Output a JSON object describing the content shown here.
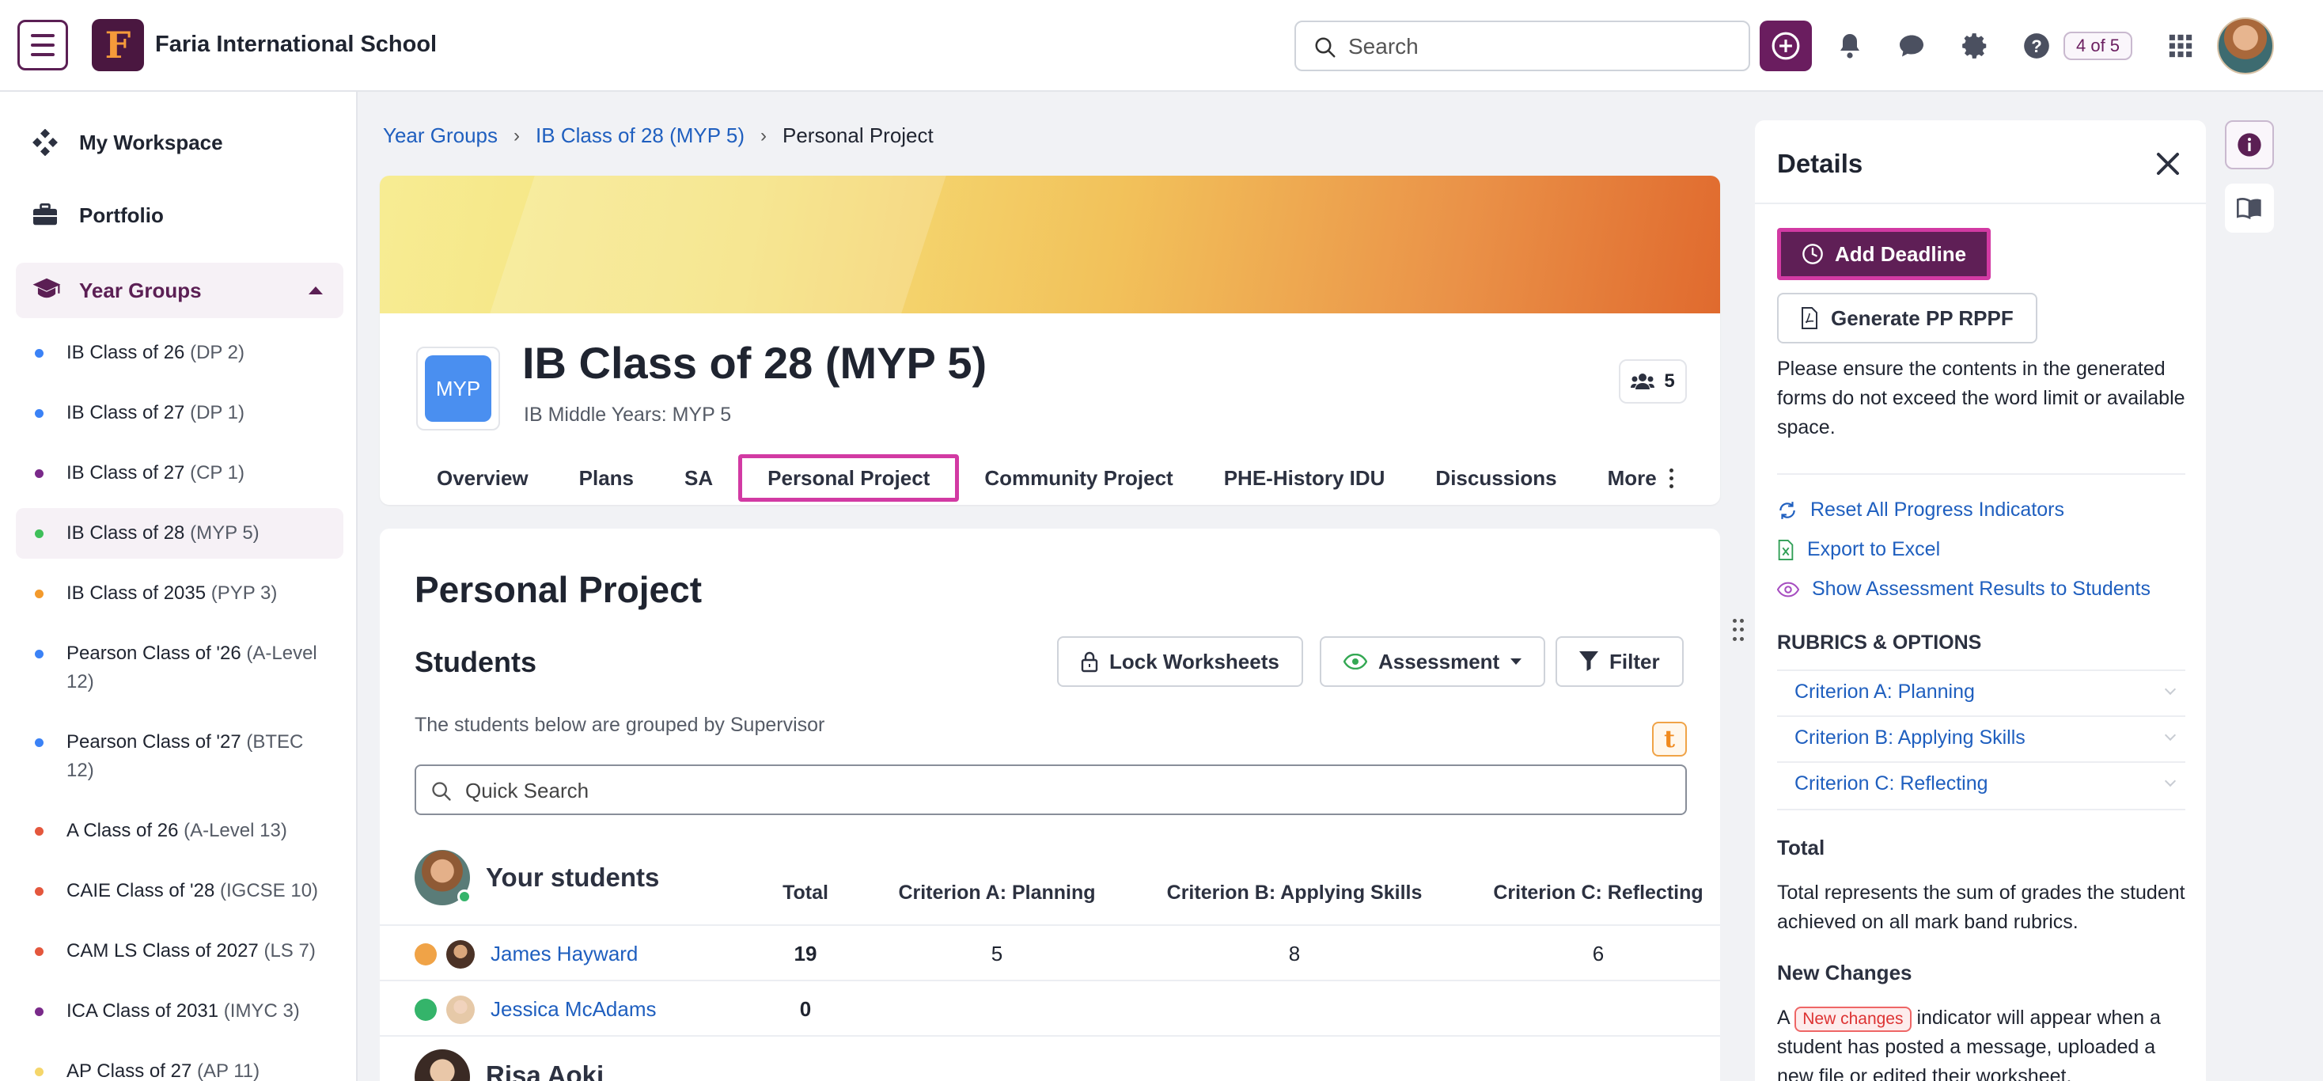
{
  "topbar": {
    "school_name": "Faria International School",
    "logo_letter": "F",
    "search_placeholder": "Search",
    "page_count": "4 of 5",
    "icons": [
      "menu-icon",
      "plus-circle-icon",
      "bell-icon",
      "chat-icon",
      "gear-icon",
      "help-icon",
      "apps-grid-icon"
    ]
  },
  "sidebar": {
    "workspace": "My Workspace",
    "portfolio": "Portfolio",
    "year_groups": "Year Groups",
    "items": [
      {
        "name": "IB Class of 26",
        "suffix": "(DP 2)",
        "color": "#3b82f6"
      },
      {
        "name": "IB Class of 27",
        "suffix": "(DP 1)",
        "color": "#3b82f6"
      },
      {
        "name": "IB Class of 27",
        "suffix": "(CP 1)",
        "color": "#7a2a8a"
      },
      {
        "name": "IB Class of 28",
        "suffix": "(MYP 5)",
        "color": "#3fbf5a"
      },
      {
        "name": "IB Class of 2035",
        "suffix": "(PYP 3)",
        "color": "#f39a2c"
      },
      {
        "name": "Pearson Class of '26",
        "suffix": "(A-Level 12)",
        "color": "#3b82f6"
      },
      {
        "name": "Pearson Class of '27",
        "suffix": "(BTEC 12)",
        "color": "#3b82f6"
      },
      {
        "name": "A Class of 26",
        "suffix": "(A-Level 13)",
        "color": "#e4573d"
      },
      {
        "name": "CAIE Class of '28",
        "suffix": "(IGCSE 10)",
        "color": "#e4573d"
      },
      {
        "name": "CAM LS Class of 2027",
        "suffix": "(LS 7)",
        "color": "#e4573d"
      },
      {
        "name": "ICA Class of 2031",
        "suffix": "(IMYC 3)",
        "color": "#7a2a8a"
      },
      {
        "name": "AP Class of 27",
        "suffix": "(AP 11)",
        "color": "#f5d66a"
      }
    ]
  },
  "breadcrumb": {
    "l1": "Year Groups",
    "l2": "IB Class of 28 (MYP 5)",
    "current": "Personal Project"
  },
  "class": {
    "logo_text": "MYP",
    "title": "IB Class of 28 (MYP 5)",
    "subtitle": "IB Middle Years: MYP 5",
    "member_count": "5",
    "tabs": [
      "Overview",
      "Plans",
      "SA",
      "Personal Project",
      "Community Project",
      "PHE-History IDU",
      "Discussions",
      "More"
    ]
  },
  "project": {
    "title": "Personal Project",
    "students_title": "Students",
    "lock_btn": "Lock Worksheets",
    "assessment_btn": "Assessment",
    "filter_btn": "Filter",
    "grouped_note": "The students below are grouped by Supervisor",
    "t_badge": "t",
    "quick_search_placeholder": "Quick Search",
    "group_title": "Your students",
    "columns": [
      "Total",
      "Criterion A: Planning",
      "Criterion B: Applying Skills",
      "Criterion C: Reflecting"
    ],
    "rows": [
      {
        "name": "James Hayward",
        "total": "19",
        "a": "5",
        "b": "8",
        "c": "6",
        "status_color": "#f0a347"
      },
      {
        "name": "Jessica McAdams",
        "total": "0",
        "a": "",
        "b": "",
        "c": "",
        "status_color": "#34b46a"
      }
    ],
    "next_group": "Risa Aoki"
  },
  "details": {
    "title": "Details",
    "add_deadline": "Add Deadline",
    "generate": "Generate PP RPPF",
    "note": "Please ensure the contents in the generated forms do not exceed the word limit or available space.",
    "reset": "Reset All Progress Indicators",
    "export": "Export to Excel",
    "show_results": "Show Assessment Results to Students",
    "rubrics_heading": "RUBRICS & OPTIONS",
    "rubrics": [
      "Criterion A: Planning",
      "Criterion B: Applying Skills",
      "Criterion C: Reflecting"
    ],
    "total_heading": "Total",
    "total_text": "Total represents the sum of grades the student achieved on all mark band rubrics.",
    "new_changes_heading": "New Changes",
    "new_changes_a": "A",
    "new_changes_badge": "New changes",
    "new_changes_text": "indicator will appear when a student has posted a message, uploaded a new file or edited their worksheet."
  }
}
